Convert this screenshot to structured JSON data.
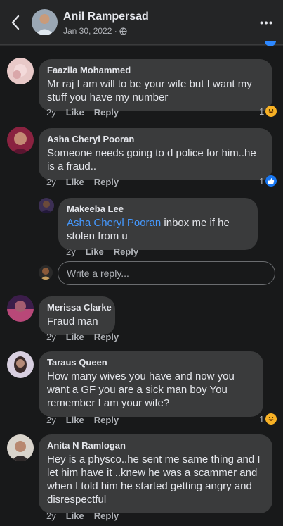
{
  "header": {
    "title": "Anil Rampersad",
    "date": "Jan 30, 2022 ·",
    "audience_icon": "globe-icon"
  },
  "comments": [
    {
      "author": "Faazila Mohammed",
      "text": "Mr raj I am will to be your wife but I want my stuff you have my number",
      "age": "2y",
      "like": "Like",
      "reply": "Reply",
      "reaction": {
        "count": "1",
        "type": "haha"
      }
    },
    {
      "author": "Asha Cheryl Pooran",
      "text": "Someone needs going to d police for him..he is a fraud..",
      "age": "2y",
      "like": "Like",
      "reply": "Reply",
      "reaction": {
        "count": "1",
        "type": "like"
      }
    },
    {
      "author": "Makeeba Lee",
      "mention": "Asha Cheryl Pooran",
      "text": " inbox me if he stolen from u",
      "age": "2y",
      "like": "Like",
      "reply": "Reply"
    },
    {
      "author": "Merissa Clarke",
      "text": "Fraud man",
      "age": "2y",
      "like": "Like",
      "reply": "Reply"
    },
    {
      "author": "Taraus Queen",
      "text": "How many wives you have and now you want a GF you are a sick man boy You remember I am your wife?",
      "age": "2y",
      "like": "Like",
      "reply": "Reply",
      "reaction": {
        "count": "1",
        "type": "haha"
      }
    },
    {
      "author": "Anita N Ramlogan",
      "text": "Hey is a physco..he sent me same thing and I let him have it ..knew he was a scammer and when I told him he started getting angry and disrespectful",
      "age": "2y",
      "like": "Like",
      "reply": "Reply"
    }
  ],
  "reply_input": {
    "placeholder": "Write a reply..."
  },
  "colors": {
    "background": "#18191a",
    "bubble": "#3a3b3c",
    "mention": "#4599ff",
    "like_blue": "#1877f2",
    "haha_yellow": "#f7b125"
  }
}
